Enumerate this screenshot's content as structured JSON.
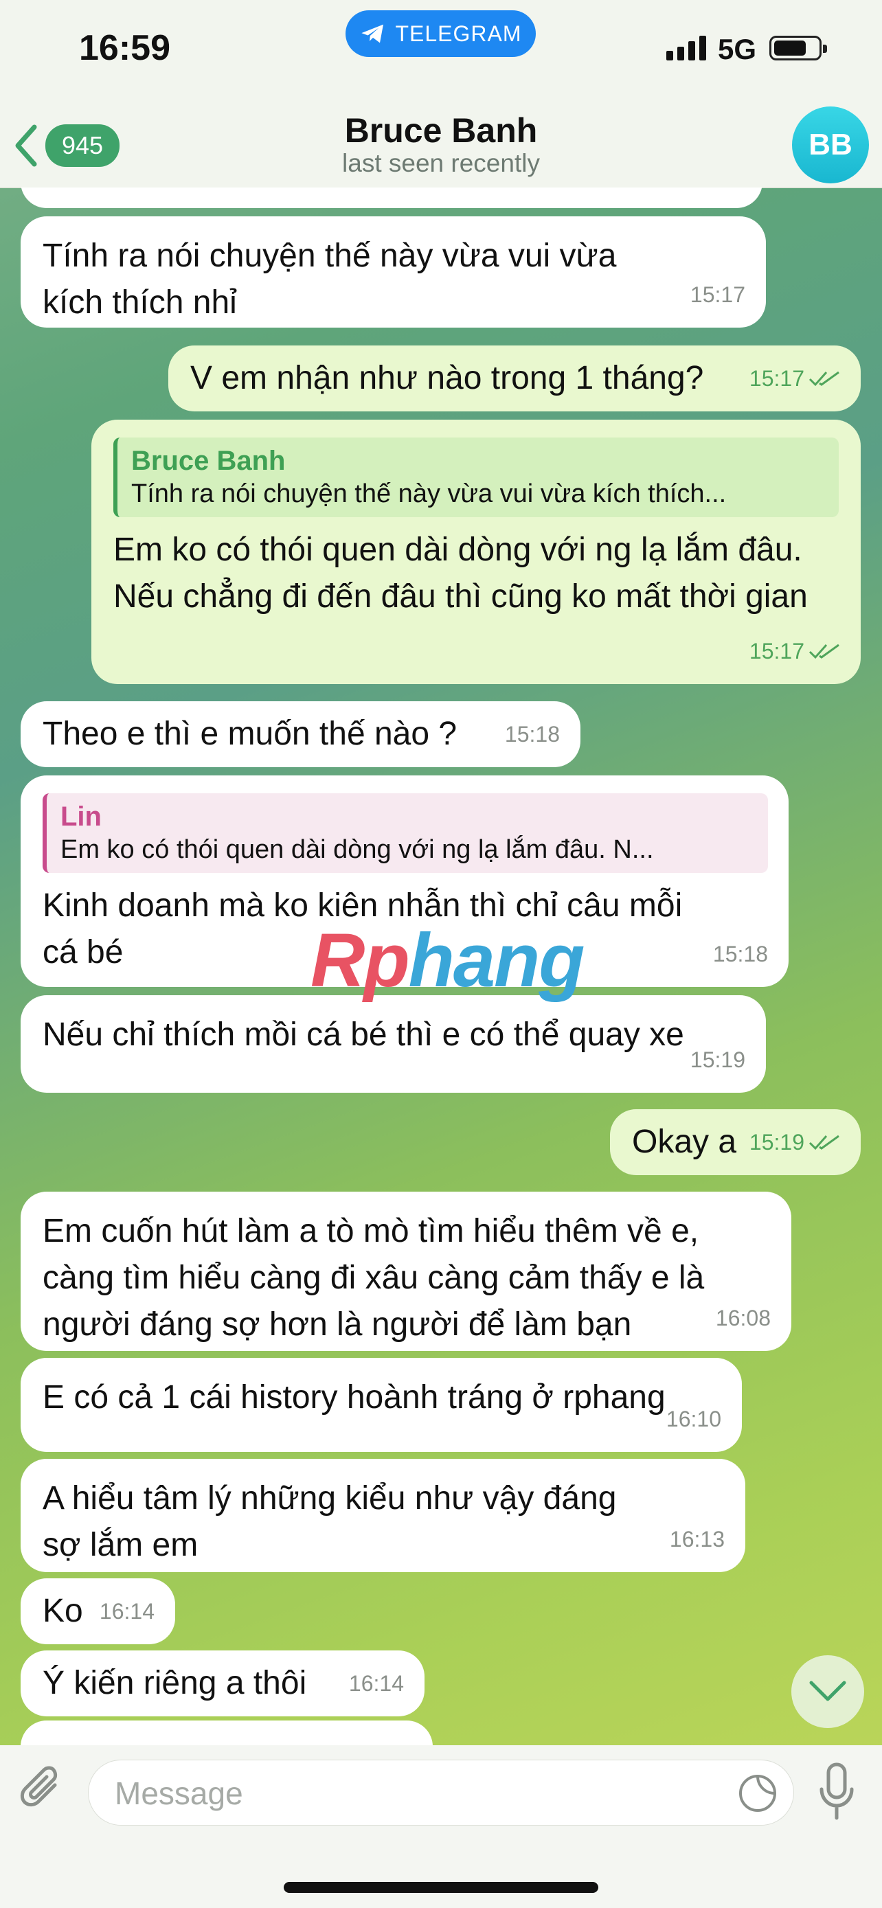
{
  "status_bar": {
    "time": "16:59",
    "app_pill": "TELEGRAM",
    "network": "5G"
  },
  "header": {
    "back_count": "945",
    "name": "Bruce Banh",
    "status": "last seen recently",
    "avatar_initials": "BB"
  },
  "messages": [
    {
      "dir": "in",
      "text": "Tính ra nói chuyện thế này vừa vui vừa kích thích nhỉ",
      "time": "15:17"
    },
    {
      "dir": "out",
      "text": "V em nhận như nào trong 1 tháng?",
      "time": "15:17"
    },
    {
      "dir": "out",
      "reply_name": "Bruce Banh",
      "reply_text": "Tính ra nói chuyện thế này vừa vui vừa kích thích...",
      "text": "Em ko có thói quen dài dòng với ng lạ lắm đâu. Nếu chẳng đi đến đâu thì cũng ko mất thời gian",
      "time": "15:17"
    },
    {
      "dir": "in",
      "text": "Theo e thì e muốn thế nào ?",
      "time": "15:18"
    },
    {
      "dir": "in",
      "reply_name": "Lin",
      "reply_text": "Em ko có thói quen dài dòng với ng lạ lắm đâu. N...",
      "text": "Kinh doanh mà ko kiên nhẫn thì chỉ câu mỗi cá bé",
      "time": "15:18"
    },
    {
      "dir": "in",
      "text": "Nếu chỉ thích mồi cá bé thì e có thể quay xe",
      "time": "15:19"
    },
    {
      "dir": "out",
      "text": "Okay a",
      "time": "15:19"
    },
    {
      "dir": "in",
      "text": "Em cuốn hút làm a tò mò tìm hiểu thêm về e, càng tìm hiểu càng đi xâu càng cảm thấy e là người đáng sợ hơn là người để làm bạn",
      "time": "16:08"
    },
    {
      "dir": "in",
      "text": "E có cả 1 cái history hoành tráng ở rphang",
      "time": "16:10"
    },
    {
      "dir": "in",
      "text": "A hiểu tâm lý những kiểu như vậy đáng sợ lắm em",
      "time": "16:13"
    },
    {
      "dir": "in",
      "text": "Ko",
      "time": "16:14"
    },
    {
      "dir": "in",
      "text": "Ý kiến riêng a thôi",
      "time": "16:14"
    }
  ],
  "watermark": {
    "part1": "Rp",
    "part2": "hang"
  },
  "input": {
    "placeholder": "Message"
  },
  "colors": {
    "accent": "#1e88f2",
    "badge": "#3fa36a",
    "out_bubble": "#e9f8cf",
    "in_bubble": "#ffffff"
  },
  "icons": [
    "telegram-icon",
    "signal-icon",
    "battery-icon",
    "back-chevron-icon",
    "double-check-icon",
    "scroll-down-icon",
    "attach-icon",
    "sticker-icon",
    "mic-icon"
  ]
}
